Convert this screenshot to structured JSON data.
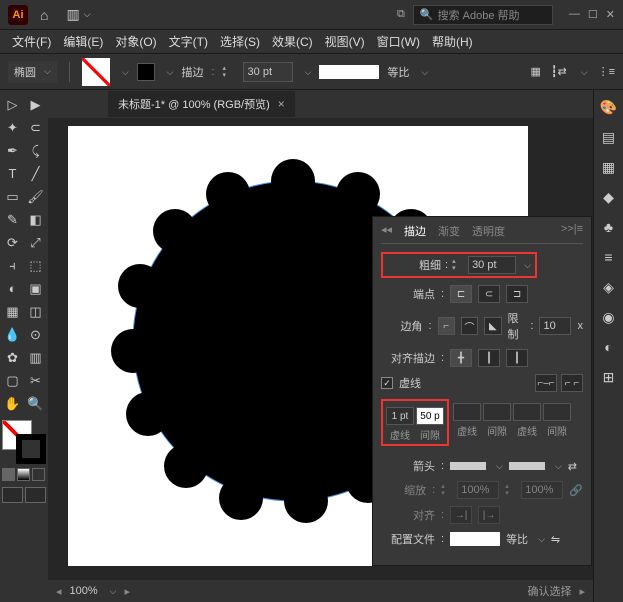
{
  "titlebar": {
    "search_placeholder": "搜索 Adobe 帮助"
  },
  "menu": {
    "file": "文件(F)",
    "edit": "编辑(E)",
    "object": "对象(O)",
    "type": "文字(T)",
    "select": "选择(S)",
    "effect": "效果(C)",
    "view": "视图(V)",
    "window": "窗口(W)",
    "help": "帮助(H)"
  },
  "ctrl": {
    "shape": "椭圆",
    "stroke_label": "描边",
    "stroke_value": "30 pt",
    "uniform": "等比"
  },
  "doc": {
    "title": "未标题-1* @ 100% (RGB/预览)"
  },
  "status": {
    "zoom": "100%",
    "select": "确认选择"
  },
  "panel": {
    "tab_stroke": "描边",
    "tab_gradient": "渐变",
    "tab_transparency": "透明度",
    "weight_label": "粗细",
    "weight_value": "30 pt",
    "cap_label": "端点",
    "corner_label": "边角",
    "limit_label": "限制",
    "limit_value": "10",
    "limit_unit": "x",
    "align_label": "对齐描边",
    "dashed_label": "虚线",
    "dash1": "1 pt",
    "gap1": "50 p",
    "dash_label": "虚线",
    "gap_label": "间隙",
    "arrow_label": "箭头",
    "scale_label": "缩放",
    "scale1": "100%",
    "scale2": "100%",
    "align2_label": "对齐",
    "profile_label": "配置文件",
    "profile_value": "等比"
  }
}
